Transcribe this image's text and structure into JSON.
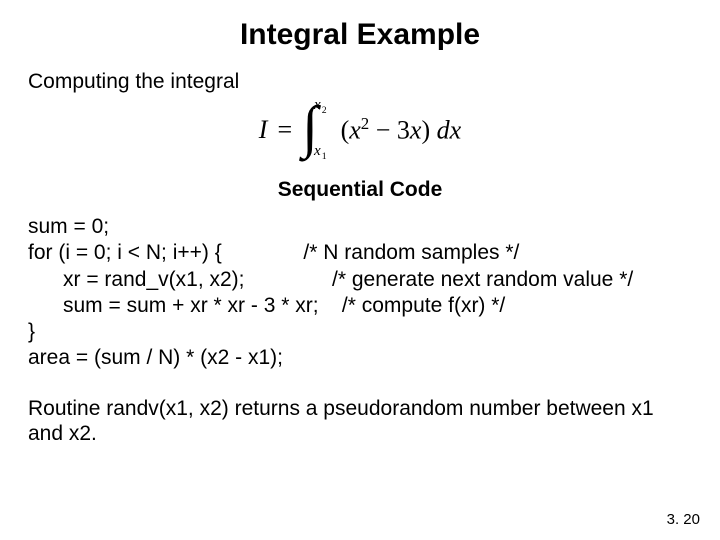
{
  "title": "Integral Example",
  "subtitle": "Computing the integral",
  "equation": {
    "lhs": "I",
    "op": "=",
    "lower": {
      "base": "x",
      "sub": "1"
    },
    "upper": {
      "base": "x",
      "sub": "2"
    },
    "integrand_text": "(x² − 3x) dx",
    "integrand_parts": {
      "open": "(",
      "x1": "x",
      "e1": "2",
      "minus": " − 3",
      "x2": "x",
      "close": ")",
      "dx": " dx"
    }
  },
  "section_heading": "Sequential Code",
  "code": {
    "l1": "sum = 0;",
    "l2": "for (i = 0; i < N; i++) {              /* N random samples */",
    "l3": "      xr = rand_v(x1, x2);               /* generate next random value */",
    "l4": "      sum = sum + xr * xr - 3 * xr;    /* compute f(xr) */",
    "l5": "}",
    "l6": "area = (sum / N) * (x2 - x1);"
  },
  "note": "Routine randv(x1, x2) returns a pseudorandom number between x1 and x2.",
  "page_number": "3. 20"
}
